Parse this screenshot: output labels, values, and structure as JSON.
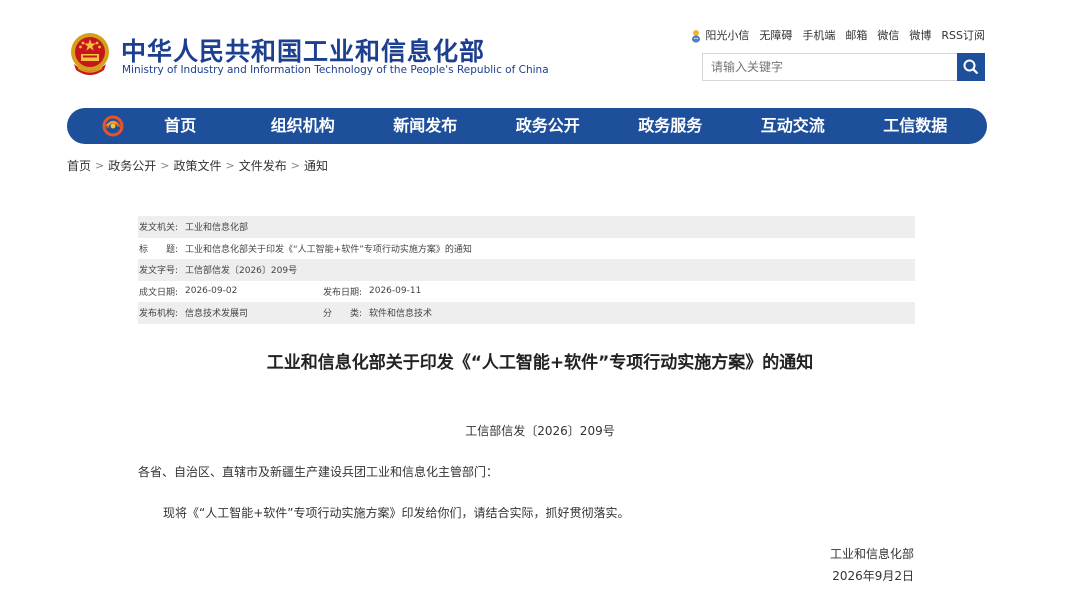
{
  "header": {
    "site_title_cn": "中华人民共和国工业和信息化部",
    "site_title_en": "Ministry of Industry and Information Technology of the People's Republic of China",
    "top_links": [
      "阳光小信",
      "无障碍",
      "手机端",
      "邮箱",
      "微信",
      "微博",
      "RSS订阅"
    ],
    "search_placeholder": "请输入关键字",
    "brand_color": "#1d4f9a"
  },
  "nav": {
    "items": [
      "首页",
      "组织机构",
      "新闻发布",
      "政务公开",
      "政务服务",
      "互动交流",
      "工信数据"
    ]
  },
  "breadcrumb": [
    "首页",
    "政务公开",
    "政策文件",
    "文件发布",
    "通知"
  ],
  "meta": {
    "issuer_label": "发文机关:",
    "issuer": "工业和信息化部",
    "title_label": "标　　题:",
    "title": "工业和信息化部关于印发《“人工智能+软件”专项行动实施方案》的通知",
    "doc_no_label": "发文字号:",
    "doc_no": "工信部信发〔2026〕209号",
    "created_label": "成文日期:",
    "created": "2026-09-02",
    "published_label": "发布日期:",
    "published": "2026-09-11",
    "org_label": "发布机构:",
    "org": "信息技术发展司",
    "category_label": "分　　类:",
    "category": "软件和信息技术"
  },
  "article": {
    "title": "工业和信息化部关于印发《“人工智能+软件”专项行动实施方案》的通知",
    "doc_number": "工信部信发〔2026〕209号",
    "salutation": "各省、自治区、直辖市及新疆生产建设兵团工业和信息化主管部门：",
    "body": "现将《“人工智能+软件”专项行动实施方案》印发给你们，请结合实际，抓好贯彻落实。",
    "signer": "工业和信息化部",
    "sign_date": "2026年9月2日"
  }
}
